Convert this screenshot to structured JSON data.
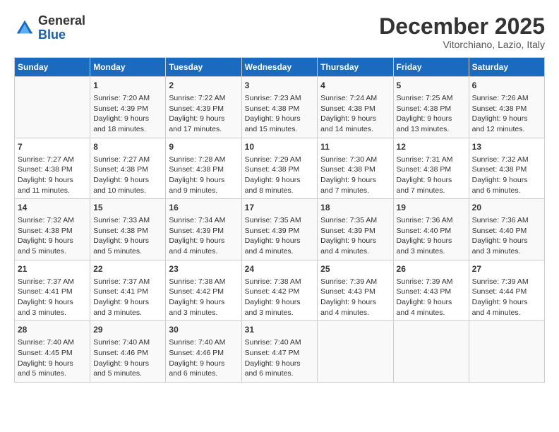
{
  "header": {
    "logo_general": "General",
    "logo_blue": "Blue",
    "month_title": "December 2025",
    "location": "Vitorchiano, Lazio, Italy"
  },
  "days_of_week": [
    "Sunday",
    "Monday",
    "Tuesday",
    "Wednesday",
    "Thursday",
    "Friday",
    "Saturday"
  ],
  "weeks": [
    [
      {
        "day": "",
        "sunrise": "",
        "sunset": "",
        "daylight": ""
      },
      {
        "day": "1",
        "sunrise": "Sunrise: 7:20 AM",
        "sunset": "Sunset: 4:39 PM",
        "daylight": "Daylight: 9 hours and 18 minutes."
      },
      {
        "day": "2",
        "sunrise": "Sunrise: 7:22 AM",
        "sunset": "Sunset: 4:39 PM",
        "daylight": "Daylight: 9 hours and 17 minutes."
      },
      {
        "day": "3",
        "sunrise": "Sunrise: 7:23 AM",
        "sunset": "Sunset: 4:38 PM",
        "daylight": "Daylight: 9 hours and 15 minutes."
      },
      {
        "day": "4",
        "sunrise": "Sunrise: 7:24 AM",
        "sunset": "Sunset: 4:38 PM",
        "daylight": "Daylight: 9 hours and 14 minutes."
      },
      {
        "day": "5",
        "sunrise": "Sunrise: 7:25 AM",
        "sunset": "Sunset: 4:38 PM",
        "daylight": "Daylight: 9 hours and 13 minutes."
      },
      {
        "day": "6",
        "sunrise": "Sunrise: 7:26 AM",
        "sunset": "Sunset: 4:38 PM",
        "daylight": "Daylight: 9 hours and 12 minutes."
      }
    ],
    [
      {
        "day": "7",
        "sunrise": "Sunrise: 7:27 AM",
        "sunset": "Sunset: 4:38 PM",
        "daylight": "Daylight: 9 hours and 11 minutes."
      },
      {
        "day": "8",
        "sunrise": "Sunrise: 7:27 AM",
        "sunset": "Sunset: 4:38 PM",
        "daylight": "Daylight: 9 hours and 10 minutes."
      },
      {
        "day": "9",
        "sunrise": "Sunrise: 7:28 AM",
        "sunset": "Sunset: 4:38 PM",
        "daylight": "Daylight: 9 hours and 9 minutes."
      },
      {
        "day": "10",
        "sunrise": "Sunrise: 7:29 AM",
        "sunset": "Sunset: 4:38 PM",
        "daylight": "Daylight: 9 hours and 8 minutes."
      },
      {
        "day": "11",
        "sunrise": "Sunrise: 7:30 AM",
        "sunset": "Sunset: 4:38 PM",
        "daylight": "Daylight: 9 hours and 7 minutes."
      },
      {
        "day": "12",
        "sunrise": "Sunrise: 7:31 AM",
        "sunset": "Sunset: 4:38 PM",
        "daylight": "Daylight: 9 hours and 7 minutes."
      },
      {
        "day": "13",
        "sunrise": "Sunrise: 7:32 AM",
        "sunset": "Sunset: 4:38 PM",
        "daylight": "Daylight: 9 hours and 6 minutes."
      }
    ],
    [
      {
        "day": "14",
        "sunrise": "Sunrise: 7:32 AM",
        "sunset": "Sunset: 4:38 PM",
        "daylight": "Daylight: 9 hours and 5 minutes."
      },
      {
        "day": "15",
        "sunrise": "Sunrise: 7:33 AM",
        "sunset": "Sunset: 4:38 PM",
        "daylight": "Daylight: 9 hours and 5 minutes."
      },
      {
        "day": "16",
        "sunrise": "Sunrise: 7:34 AM",
        "sunset": "Sunset: 4:39 PM",
        "daylight": "Daylight: 9 hours and 4 minutes."
      },
      {
        "day": "17",
        "sunrise": "Sunrise: 7:35 AM",
        "sunset": "Sunset: 4:39 PM",
        "daylight": "Daylight: 9 hours and 4 minutes."
      },
      {
        "day": "18",
        "sunrise": "Sunrise: 7:35 AM",
        "sunset": "Sunset: 4:39 PM",
        "daylight": "Daylight: 9 hours and 4 minutes."
      },
      {
        "day": "19",
        "sunrise": "Sunrise: 7:36 AM",
        "sunset": "Sunset: 4:40 PM",
        "daylight": "Daylight: 9 hours and 3 minutes."
      },
      {
        "day": "20",
        "sunrise": "Sunrise: 7:36 AM",
        "sunset": "Sunset: 4:40 PM",
        "daylight": "Daylight: 9 hours and 3 minutes."
      }
    ],
    [
      {
        "day": "21",
        "sunrise": "Sunrise: 7:37 AM",
        "sunset": "Sunset: 4:41 PM",
        "daylight": "Daylight: 9 hours and 3 minutes."
      },
      {
        "day": "22",
        "sunrise": "Sunrise: 7:37 AM",
        "sunset": "Sunset: 4:41 PM",
        "daylight": "Daylight: 9 hours and 3 minutes."
      },
      {
        "day": "23",
        "sunrise": "Sunrise: 7:38 AM",
        "sunset": "Sunset: 4:42 PM",
        "daylight": "Daylight: 9 hours and 3 minutes."
      },
      {
        "day": "24",
        "sunrise": "Sunrise: 7:38 AM",
        "sunset": "Sunset: 4:42 PM",
        "daylight": "Daylight: 9 hours and 3 minutes."
      },
      {
        "day": "25",
        "sunrise": "Sunrise: 7:39 AM",
        "sunset": "Sunset: 4:43 PM",
        "daylight": "Daylight: 9 hours and 4 minutes."
      },
      {
        "day": "26",
        "sunrise": "Sunrise: 7:39 AM",
        "sunset": "Sunset: 4:43 PM",
        "daylight": "Daylight: 9 hours and 4 minutes."
      },
      {
        "day": "27",
        "sunrise": "Sunrise: 7:39 AM",
        "sunset": "Sunset: 4:44 PM",
        "daylight": "Daylight: 9 hours and 4 minutes."
      }
    ],
    [
      {
        "day": "28",
        "sunrise": "Sunrise: 7:40 AM",
        "sunset": "Sunset: 4:45 PM",
        "daylight": "Daylight: 9 hours and 5 minutes."
      },
      {
        "day": "29",
        "sunrise": "Sunrise: 7:40 AM",
        "sunset": "Sunset: 4:46 PM",
        "daylight": "Daylight: 9 hours and 5 minutes."
      },
      {
        "day": "30",
        "sunrise": "Sunrise: 7:40 AM",
        "sunset": "Sunset: 4:46 PM",
        "daylight": "Daylight: 9 hours and 6 minutes."
      },
      {
        "day": "31",
        "sunrise": "Sunrise: 7:40 AM",
        "sunset": "Sunset: 4:47 PM",
        "daylight": "Daylight: 9 hours and 6 minutes."
      },
      {
        "day": "",
        "sunrise": "",
        "sunset": "",
        "daylight": ""
      },
      {
        "day": "",
        "sunrise": "",
        "sunset": "",
        "daylight": ""
      },
      {
        "day": "",
        "sunrise": "",
        "sunset": "",
        "daylight": ""
      }
    ]
  ]
}
